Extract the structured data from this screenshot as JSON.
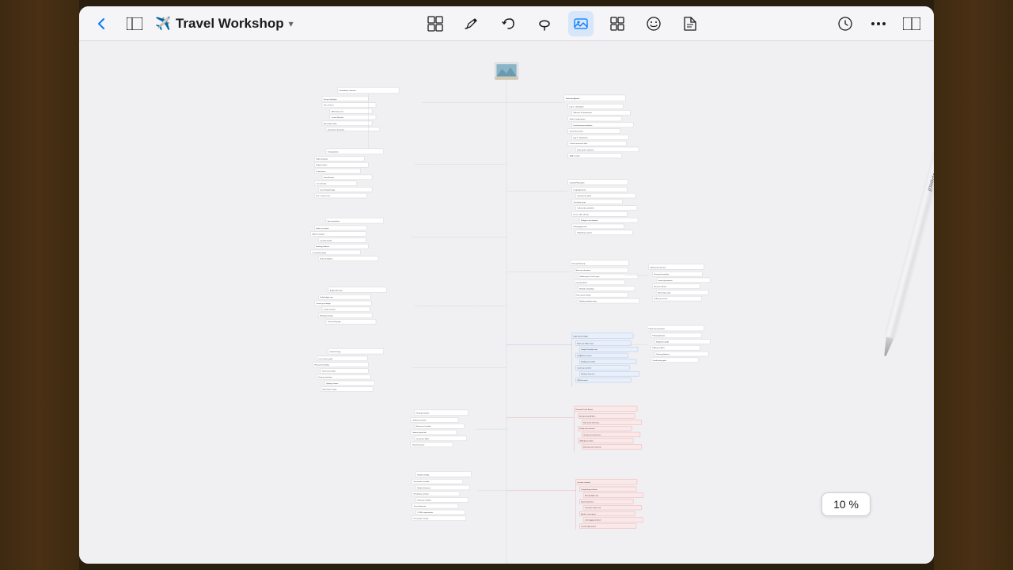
{
  "app": {
    "title": "Travel Workshop",
    "icon": "✈️",
    "zoom_level": "10 %"
  },
  "toolbar": {
    "back_label": "‹",
    "sidebar_icon": "sidebar-icon",
    "title": "Travel Workshop",
    "plane_icon": "airplane-icon",
    "chevron_icon": "chevron-down-icon",
    "grid_icon": "grid-icon",
    "pen_icon": "pen-icon",
    "arrow_left_icon": "arrow-left-icon",
    "curve_icon": "curve-icon",
    "image_icon": "image-icon",
    "layout_icon": "layout-icon",
    "emoji_icon": "emoji-icon",
    "doc_icon": "doc-icon",
    "clock_icon": "clock-icon",
    "more_icon": "more-icon",
    "panel_icon": "panel-icon"
  },
  "zoom": {
    "value": "10 %"
  },
  "mindmap": {
    "description": "Travel Workshop mind map at 10% zoom showing dense hierarchical nodes"
  }
}
